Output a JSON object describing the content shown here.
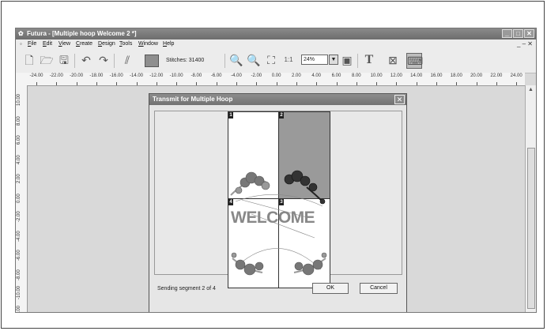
{
  "window": {
    "title": "Futura - [Multiple hoop Welcome 2 *]",
    "controls": {
      "minimize": "_",
      "restore": "□",
      "close": "✕"
    }
  },
  "menu": {
    "items": [
      "File",
      "Edit",
      "View",
      "Create",
      "Design",
      "Tools",
      "Window",
      "Help"
    ],
    "right_controls": "_ ‒ ✕"
  },
  "toolbar": {
    "stitches_label": "Stitches: 31400",
    "zoom_value": "24%",
    "zoom_arrow": "▼",
    "text_tool": "T"
  },
  "ruler_h": [
    "-24.00",
    "-22.00",
    "-20.00",
    "-18.00",
    "-16.00",
    "-14.00",
    "-12.00",
    "-10.00",
    "-8.00",
    "-6.00",
    "-4.00",
    "-2.00",
    "0.00",
    "2.00",
    "4.00",
    "6.00",
    "8.00",
    "10.00",
    "12.00",
    "14.00",
    "16.00",
    "18.00",
    "20.00",
    "22.00",
    "24.00"
  ],
  "ruler_v": [
    "10.00",
    "8.00",
    "6.00",
    "4.00",
    "2.00",
    "0.00",
    "-2.00",
    "-4.00",
    "-6.00",
    "-8.00",
    "-10.00",
    "-12.00"
  ],
  "dialog": {
    "title": "Transmit for Multiple Hoop",
    "close": "✕",
    "segments": [
      "1",
      "2",
      "4",
      "3"
    ],
    "design_text": "WELCOME",
    "status": "Sending segment 2 of 4",
    "ok_label": "OK",
    "cancel_label": "Cancel"
  },
  "colors": {
    "active_segment": "#9a9a9a",
    "segment_bg": "#ffffff",
    "titlebar": "#7a7a7a"
  }
}
